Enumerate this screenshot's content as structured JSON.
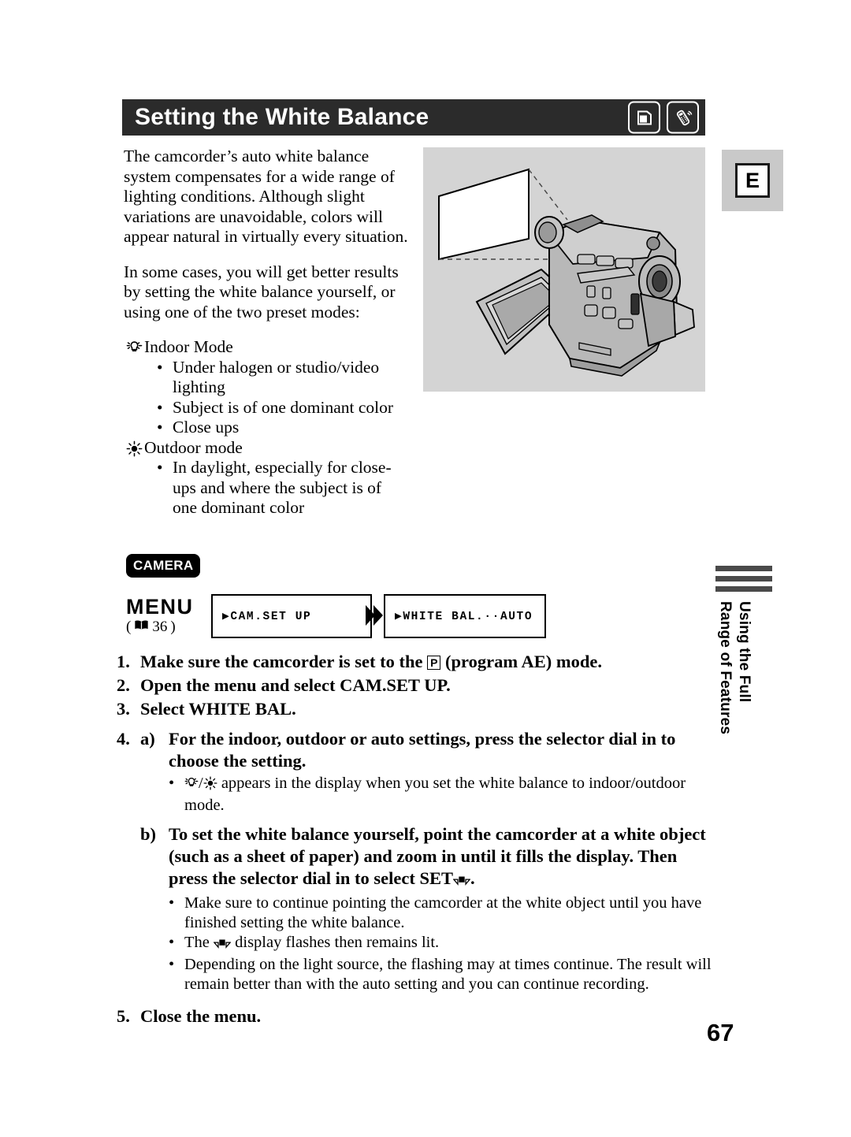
{
  "header": {
    "title": "Setting the White Balance",
    "icons": [
      {
        "name": "cassette-tape-icon",
        "label": "tape"
      },
      {
        "name": "wireless-remote-icon",
        "label": "remote"
      }
    ]
  },
  "edition_tab": {
    "label": "E"
  },
  "intro": {
    "paragraph_1": "The camcorder’s auto white balance system compensates for a wide range of lighting conditions. Although slight variations are unavoidable, colors will appear natural in virtually every situation.",
    "paragraph_2": "In some cases, you will get better results by setting the white balance yourself, or using one of the two preset modes:"
  },
  "modes": [
    {
      "icon": "indoor-lightbulb-icon",
      "label": "Indoor Mode",
      "bullets": [
        "Under halogen or studio/video lighting",
        "Subject is of one dominant color",
        "Close ups"
      ]
    },
    {
      "icon": "outdoor-sun-icon",
      "label": "Outdoor mode",
      "bullets": [
        "In daylight, especially for close-ups and where the subject is of one dominant color"
      ]
    }
  ],
  "illustration": {
    "name": "camcorder-pointing-at-white-paper-illustration",
    "caption": ""
  },
  "menu_flow": {
    "mode_badge": "CAMERA",
    "menu_label": "MENU",
    "page_reference_open": "(",
    "page_reference": "36",
    "page_reference_close": ")",
    "boxes": [
      {
        "text": "▶CAM.SET UP"
      },
      {
        "text": "▶WHITE BAL.··AUTO"
      }
    ]
  },
  "steps": [
    {
      "num": "1.",
      "text_before_icon": "Make sure the camcorder is set to the ",
      "inline_icon": "P",
      "text_after_icon": " (program AE) mode."
    },
    {
      "num": "2.",
      "text": "Open the menu and select CAM.SET UP."
    },
    {
      "num": "3.",
      "text": "Select WHITE BAL."
    },
    {
      "num": "4.",
      "sub_a": {
        "letter": "a)",
        "text": "For the indoor, outdoor or auto settings, press the selector dial in to choose the setting.",
        "notes_prefix": " appears in the display when you set the white balance to indoor/outdoor mode."
      },
      "sub_b": {
        "letter": "b)",
        "text_before_icon": "To set the white balance yourself, point the camcorder at a white object (such as a sheet of paper) and zoom in until it fills the display. Then press the selector dial in to select SET",
        "text_after_icon": ".",
        "notes": [
          "Make sure to continue pointing the camcorder at the white object until you have finished setting the white balance.",
          "Depending on the light source, the flashing may at times continue. The result will remain better than with the auto setting and you can continue recording."
        ],
        "note_flash_before": "The ",
        "note_flash_after": " display flashes then remains lit."
      }
    },
    {
      "num": "5.",
      "text": "Close the menu."
    }
  ],
  "side_tab": {
    "text": "Using the Full\nRange of Features",
    "bar_count": 3
  },
  "page_number": "67",
  "colors": {
    "header_bg": "#2b2b2b",
    "illustration_bg": "#d4d4d4",
    "tab_bg": "#c9c9c9",
    "bar": "#4a4a4a"
  }
}
